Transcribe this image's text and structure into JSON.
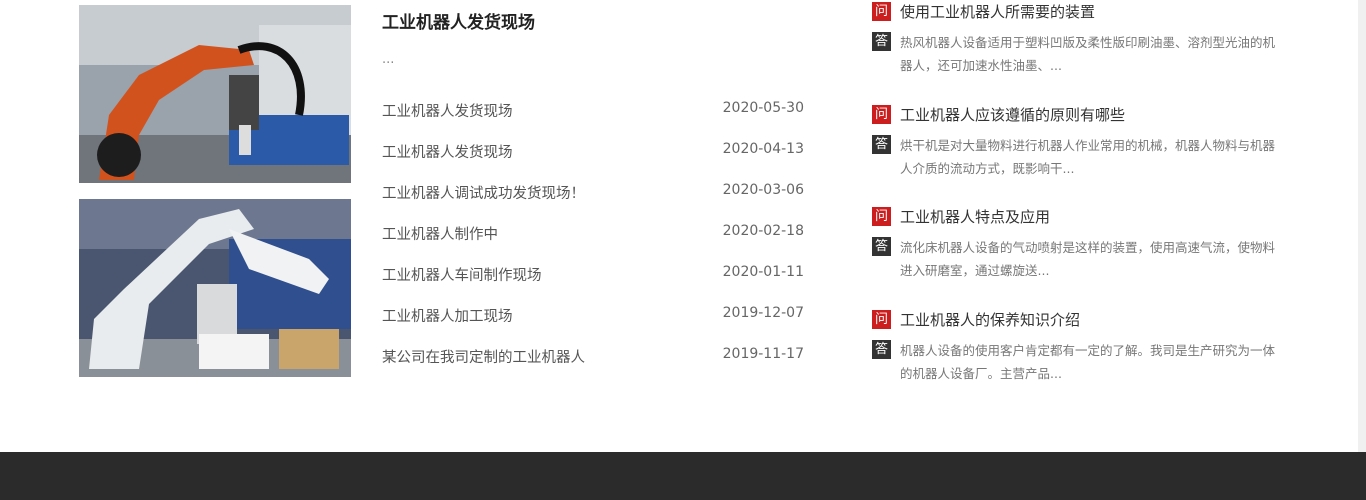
{
  "news": {
    "featured": {
      "title": "工业机器人发货现场",
      "excerpt": "..."
    },
    "items": [
      {
        "title": "工业机器人发货现场",
        "date": "2020-05-30"
      },
      {
        "title": "工业机器人发货现场",
        "date": "2020-04-13"
      },
      {
        "title": "工业机器人调试成功发货现场！",
        "date": "2020-03-06"
      },
      {
        "title": "工业机器人制作中",
        "date": "2020-02-18"
      },
      {
        "title": "工业机器人车间制作现场",
        "date": "2020-01-11"
      },
      {
        "title": "工业机器人加工现场",
        "date": "2019-12-07"
      },
      {
        "title": "某公司在我司定制的工业机器人",
        "date": "2019-11-17"
      }
    ]
  },
  "faq": {
    "q_label": "问",
    "a_label": "答",
    "items": [
      {
        "question": "使用工业机器人所需要的装置",
        "answer": "热风机器人设备适用于塑料凹版及柔性版印刷油墨、溶剂型光油的机器人，还可加速水性油墨、..."
      },
      {
        "question": "工业机器人应该遵循的原则有哪些",
        "answer": "烘干机是对大量物料进行机器人作业常用的机械，机器人物料与机器人介质的流动方式，既影响干..."
      },
      {
        "question": "工业机器人特点及应用",
        "answer": "流化床机器人设备的气动喷射是这样的装置，使用高速气流，使物料进入研磨室，通过螺旋送..."
      },
      {
        "question": "工业机器人的保养知识介绍",
        "answer": "机器人设备的使用客户肯定都有一定的了解。我司是生产研究为一体的机器人设备厂。主营产品..."
      }
    ]
  },
  "colors": {
    "question_badge": "#cc1e1e",
    "answer_badge": "#333333",
    "footer": "#2b2b2b"
  }
}
